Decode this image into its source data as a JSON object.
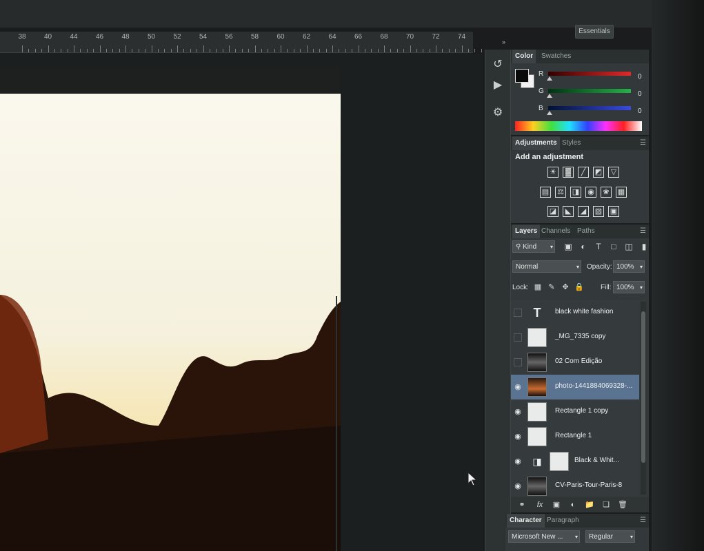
{
  "app": {
    "workspace_label": "Essentials",
    "collapse_icon": "double-chevron-right-icon"
  },
  "ruler": {
    "labels": [
      "38",
      "40",
      "44",
      "46",
      "48",
      "50",
      "52",
      "54",
      "56",
      "58",
      "60",
      "62",
      "64",
      "66",
      "68",
      "70",
      "72",
      "74"
    ]
  },
  "toolstrip": {
    "icons": [
      "history-icon",
      "play-actions-icon",
      "properties-icon"
    ]
  },
  "color_panel": {
    "tabs": [
      "Color",
      "Swatches"
    ],
    "channels": [
      {
        "label": "R",
        "value": "0",
        "color": "#e02a2a"
      },
      {
        "label": "G",
        "value": "0",
        "color": "#27b04a"
      },
      {
        "label": "B",
        "value": "0",
        "color": "#3a4ae0"
      }
    ]
  },
  "adjustments_panel": {
    "tabs": [
      "Adjustments",
      "Styles"
    ],
    "heading": "Add an adjustment",
    "row1": [
      "brightness-icon",
      "levels-icon",
      "curves-icon",
      "exposure-icon",
      "vibrance-icon"
    ],
    "row2": [
      "hue-saturation-icon",
      "color-balance-icon",
      "black-white-icon",
      "photo-filter-icon",
      "channel-mixer-icon",
      "color-lookup-icon"
    ],
    "row3": [
      "invert-icon",
      "posterize-icon",
      "threshold-icon",
      "gradient-map-icon",
      "selective-color-icon"
    ]
  },
  "layers_panel": {
    "tabs": [
      "Layers",
      "Channels",
      "Paths"
    ],
    "filter_kind": "Kind",
    "blend_mode": "Normal",
    "opacity_label": "Opacity:",
    "opacity_value": "100%",
    "lock_label": "Lock:",
    "fill_label": "Fill:",
    "fill_value": "100%",
    "layers": [
      {
        "name": "black white fashion",
        "visible": false,
        "thumb": "text",
        "selected": false
      },
      {
        "name": "_MG_7335 copy",
        "visible": false,
        "thumb": "blank",
        "selected": false
      },
      {
        "name": "02 Com Edição",
        "visible": false,
        "thumb": "dark",
        "selected": false
      },
      {
        "name": "photo-1441884069328-...",
        "visible": true,
        "thumb": "photo",
        "selected": true
      },
      {
        "name": "Rectangle 1 copy",
        "visible": true,
        "thumb": "blank",
        "selected": false
      },
      {
        "name": "Rectangle 1",
        "visible": true,
        "thumb": "blank",
        "selected": false
      },
      {
        "name": "Black & Whit...",
        "visible": true,
        "thumb": "adjust",
        "selected": false
      },
      {
        "name": "CV-Paris-Tour-Paris-8",
        "visible": true,
        "thumb": "dark",
        "selected": false
      }
    ]
  },
  "character_panel": {
    "tabs": [
      "Character",
      "Paragraph"
    ],
    "font_family": "Microsoft New ...",
    "font_style": "Regular"
  }
}
